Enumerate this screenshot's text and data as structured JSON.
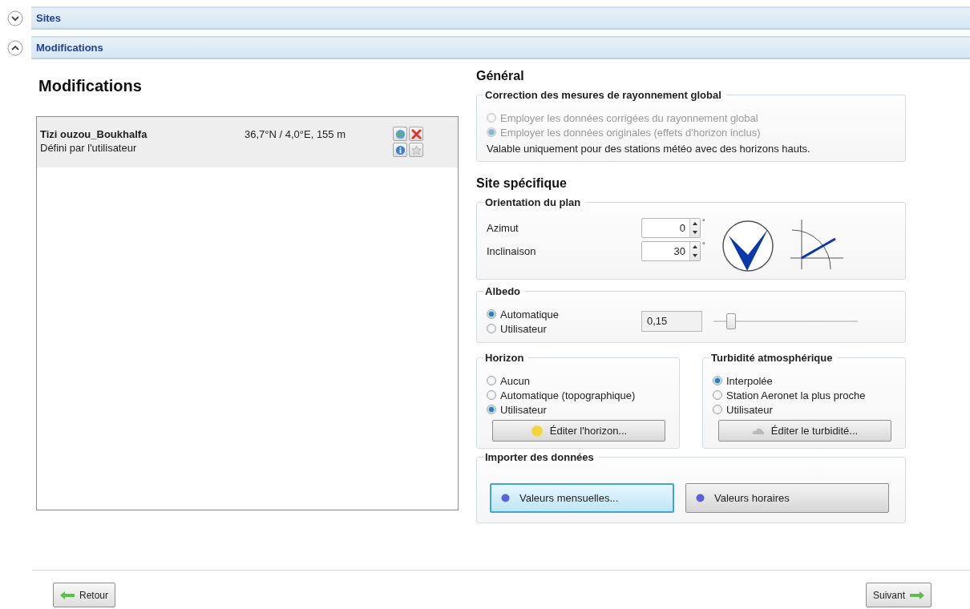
{
  "sections": [
    {
      "title": "Sites",
      "expanded": false
    },
    {
      "title": "Modifications",
      "expanded": true
    }
  ],
  "heading": "Modifications",
  "sites": [
    {
      "name": "Tizi ouzou_Boukhalfa",
      "coords": "36,7°N / 4,0°E, 155 m",
      "source": "Défini par l'utilisateur",
      "selected": true
    }
  ],
  "general": {
    "title": "Général",
    "correction": {
      "title": "Correction des mesures de rayonnement global",
      "disabled": true,
      "options": [
        {
          "label": "Employer les données corrigées du rayonnement global",
          "selected": false
        },
        {
          "label": "Employer les données originales (effets d'horizon inclus)",
          "selected": true
        }
      ],
      "note": "Valable uniquement pour des stations météo avec des horizons hauts."
    }
  },
  "site_specific": {
    "title": "Site spécifique",
    "orientation": {
      "title": "Orientation du plan",
      "fields": [
        {
          "label": "Azimut",
          "value": "0",
          "unit": "°"
        },
        {
          "label": "Inclinaison",
          "value": "30",
          "unit": "°"
        }
      ]
    },
    "albedo": {
      "title": "Albedo",
      "options": [
        {
          "label": "Automatique",
          "selected": true
        },
        {
          "label": "Utilisateur",
          "selected": false
        }
      ],
      "value": "0,15",
      "level": 0.12
    },
    "horizon": {
      "title": "Horizon",
      "options": [
        {
          "label": "Aucun",
          "selected": false
        },
        {
          "label": "Automatique (topographique)",
          "selected": false
        },
        {
          "label": "Utilisateur",
          "selected": true
        }
      ],
      "button": "Éditer l'horizon..."
    },
    "turbidity": {
      "title": "Turbidité atmosphérique",
      "options": [
        {
          "label": "Interpolée",
          "selected": true
        },
        {
          "label": "Station Aeronet la plus proche",
          "selected": false
        },
        {
          "label": "Utilisateur",
          "selected": false
        }
      ],
      "button": "Éditer le turbidité..."
    },
    "import": {
      "title": "Importer des données",
      "buttons": [
        {
          "label": "Valeurs mensuelles...",
          "focused": true
        },
        {
          "label": "Valeurs horaires",
          "focused": false
        }
      ]
    }
  },
  "footer": {
    "back": "Retour",
    "next": "Suivant"
  }
}
